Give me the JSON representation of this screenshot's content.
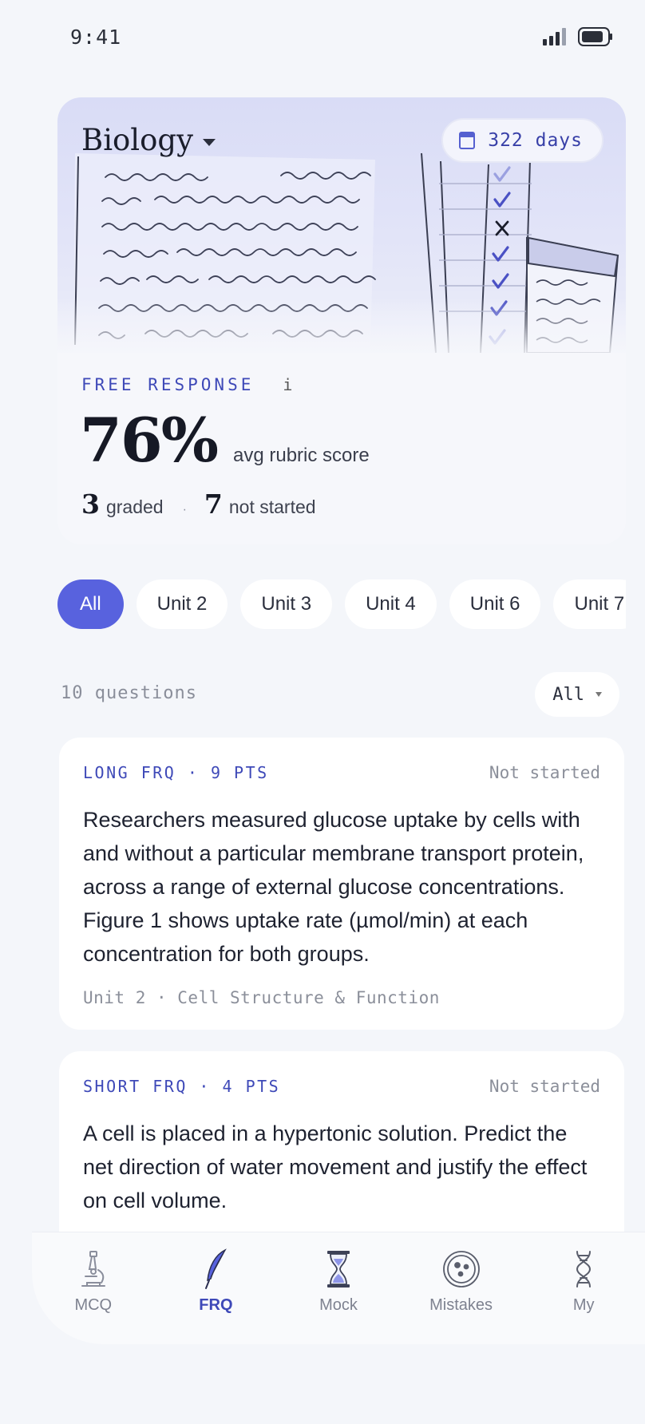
{
  "status_bar": {
    "time": "9:41"
  },
  "hero": {
    "subject": "Biology",
    "days": "322 days",
    "section_label": "FREE RESPONSE",
    "info_glyph": "i",
    "score": "76%",
    "score_desc": "avg rubric score",
    "graded_count": "3",
    "graded_label": "graded",
    "separator": "·",
    "not_started_count": "7",
    "not_started_label": "not started"
  },
  "filters": [
    "All",
    "Unit 2",
    "Unit 3",
    "Unit 4",
    "Unit 6",
    "Unit 7"
  ],
  "list": {
    "count": "10 questions",
    "sort": "All"
  },
  "questions": [
    {
      "type": "LONG FRQ · 9 PTS",
      "status": "Not started",
      "text": "Researchers measured glucose uptake by cells with and without a particular membrane transport protein, across a range of external glucose concentrations. Figure 1 shows uptake rate (µmol/min) at each concentration for both groups.",
      "unit": "Unit 2 · Cell Structure & Function"
    },
    {
      "type": "SHORT FRQ · 4 PTS",
      "status": "Not started",
      "text": "A cell is placed in a hypertonic solution. Predict the net direction of water movement and justify the effect on cell volume.",
      "unit": ""
    }
  ],
  "nav": [
    {
      "label": "MCQ",
      "icon": "microscope-icon"
    },
    {
      "label": "FRQ",
      "icon": "quill-icon",
      "active": true
    },
    {
      "label": "Mock",
      "icon": "hourglass-icon"
    },
    {
      "label": "Mistakes",
      "icon": "petri-dish-icon"
    },
    {
      "label": "My",
      "icon": "dna-icon"
    }
  ],
  "colors": {
    "accent": "#5862de",
    "accent_text": "#3e49b8",
    "background": "#f4f6fa"
  }
}
